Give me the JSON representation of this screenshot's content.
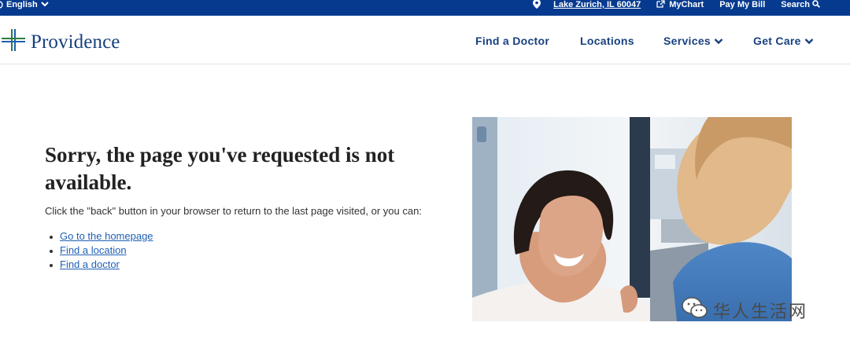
{
  "topbar": {
    "language": "English",
    "location": "Lake Zurich, IL 60047",
    "mychart": "MyChart",
    "pay_bill": "Pay My Bill",
    "search": "Search"
  },
  "brand": {
    "name": "Providence",
    "color_primary": "#17417f",
    "color_topbar": "#063a8f"
  },
  "nav": {
    "find_doctor": "Find a Doctor",
    "locations": "Locations",
    "services": "Services",
    "get_care": "Get Care"
  },
  "content": {
    "headline": "Sorry, the page you've requested is not available.",
    "subtext": "Click the \"back\" button in your browser to return to the last page visited, or you can:",
    "links": [
      "Go to the homepage",
      "Find a location",
      "Find a doctor"
    ]
  },
  "watermark": {
    "text": "华人生活网"
  },
  "icons": {
    "globe": "globe-icon",
    "chevron": "chevron-down-icon",
    "location": "map-pin-icon",
    "external": "external-link-icon",
    "search": "search-icon",
    "wechat": "wechat-icon"
  }
}
